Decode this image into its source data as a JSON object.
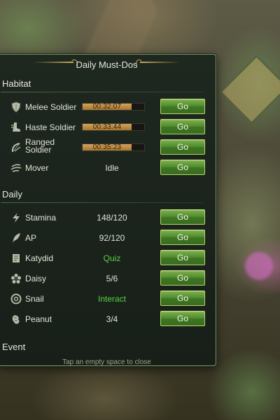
{
  "title": "Daily Must-Dos",
  "sections": {
    "habitat": "Habitat",
    "daily": "Daily",
    "event": "Event"
  },
  "habitat_rows": [
    {
      "label": "Melee Soldier",
      "icon": "shield-icon",
      "timer": "00:32:07",
      "progress": 0.8,
      "go": "Go"
    },
    {
      "label": "Haste Soldier",
      "icon": "boot-icon",
      "timer": "00:33:44",
      "progress": 0.8,
      "go": "Go"
    },
    {
      "label": "Ranged Soldier",
      "icon": "bow-icon",
      "timer": "00:35:23",
      "progress": 0.8,
      "go": "Go"
    },
    {
      "label": "Mover",
      "icon": "wind-icon",
      "status": "Idle",
      "go": "Go"
    }
  ],
  "daily_rows": [
    {
      "label": "Stamina",
      "icon": "lightning-icon",
      "value": "148/120",
      "go": "Go"
    },
    {
      "label": "AP",
      "icon": "quill-icon",
      "value": "92/120",
      "go": "Go"
    },
    {
      "label": "Katydid",
      "icon": "scroll-icon",
      "value": "Quiz",
      "go": "Go"
    },
    {
      "label": "Daisy",
      "icon": "flower-icon",
      "value": "5/6",
      "go": "Go"
    },
    {
      "label": "Snail",
      "icon": "snail-icon",
      "value": "Interact",
      "go": "Go"
    },
    {
      "label": "Peanut",
      "icon": "peanut-icon",
      "value": "3/4",
      "go": "Go"
    }
  ],
  "footer_hint": "Tap an empty space to close",
  "colors": {
    "panel_bg": "#1c261e",
    "panel_border": "#7f9a63",
    "go_button": "#4e8b2e",
    "progress_fill": "#c4944f",
    "highlight_green": "#58d13f"
  }
}
